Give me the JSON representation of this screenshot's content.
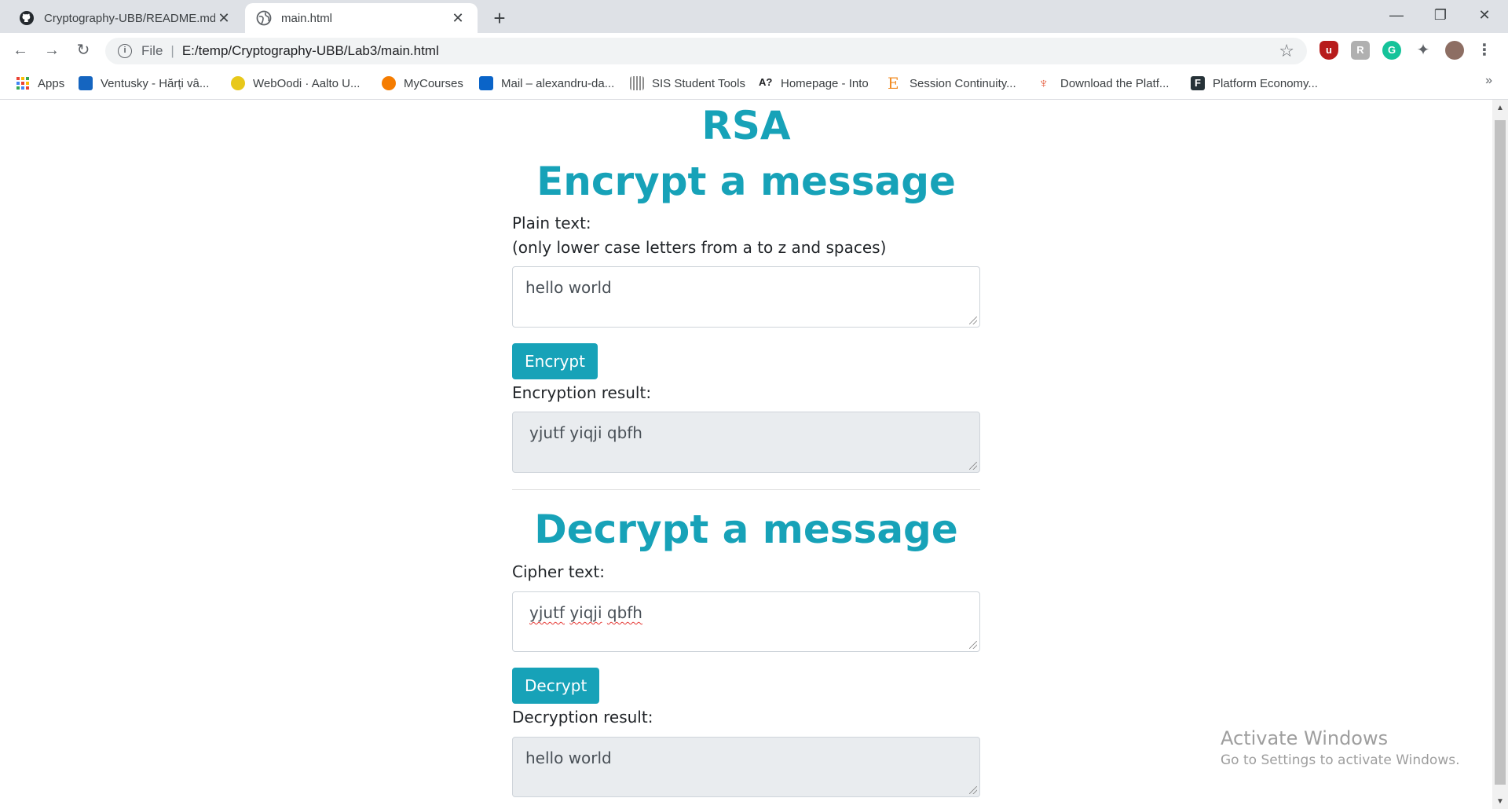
{
  "browser": {
    "tabs": [
      {
        "title": "Cryptography-UBB/README.md",
        "close": "✕"
      },
      {
        "title": "main.html",
        "close": "✕"
      }
    ],
    "new_tab": "+",
    "window_controls": {
      "minimize": "—",
      "maximize": "❐",
      "close": "✕"
    },
    "address": {
      "scheme": "File",
      "separator": "|",
      "url": "E:/temp/Cryptography-UBB/Lab3/main.html"
    },
    "bookmarks": [
      {
        "label": "Apps",
        "icon": "apps-grid-icon",
        "color": "#ea4335"
      },
      {
        "label": "Ventusky - Hărți vâ...",
        "icon": "ventusky-icon",
        "color": "#1565c0"
      },
      {
        "label": "WebOodi · Aalto U...",
        "icon": "weboodi-icon",
        "color": "#e8c81a"
      },
      {
        "label": "MyCourses",
        "icon": "mycourses-icon",
        "color": "#f57c00"
      },
      {
        "label": "Mail – alexandru-da...",
        "icon": "outlook-icon",
        "color": "#0a64c8"
      },
      {
        "label": "SIS Student Tools",
        "icon": "sis-icon",
        "color": "#8e8e8e"
      },
      {
        "label": "Homepage - Into",
        "icon": "into-icon",
        "color": "#202124"
      },
      {
        "label": "Session Continuity...",
        "icon": "e-icon",
        "color": "#f28b22"
      },
      {
        "label": "Download the Platf...",
        "icon": "download-platform-icon",
        "color": "#e55b3c"
      },
      {
        "label": "Platform Economy...",
        "icon": "platform-f-icon",
        "color": "#263238"
      }
    ],
    "bookmarks_more": "»"
  },
  "page": {
    "title": "RSA",
    "encrypt": {
      "heading": "Encrypt a message",
      "plain_label": "Plain text:",
      "plain_hint": "(only lower case letters from a to z and spaces)",
      "plain_value": "hello world",
      "button": "Encrypt",
      "result_label": "Encryption result:",
      "result_value": "yjutf yiqji qbfh"
    },
    "decrypt": {
      "heading": "Decrypt a message",
      "cipher_label": "Cipher text:",
      "cipher_words": [
        "yjutf",
        "yiqji",
        "qbfh"
      ],
      "button": "Decrypt",
      "result_label": "Decryption result:",
      "result_value": "hello world"
    }
  },
  "watermark": {
    "line1": "Activate Windows",
    "line2": "Go to Settings to activate Windows."
  },
  "colors": {
    "accent": "#17a2b8",
    "readonly_bg": "#e9ecef"
  }
}
